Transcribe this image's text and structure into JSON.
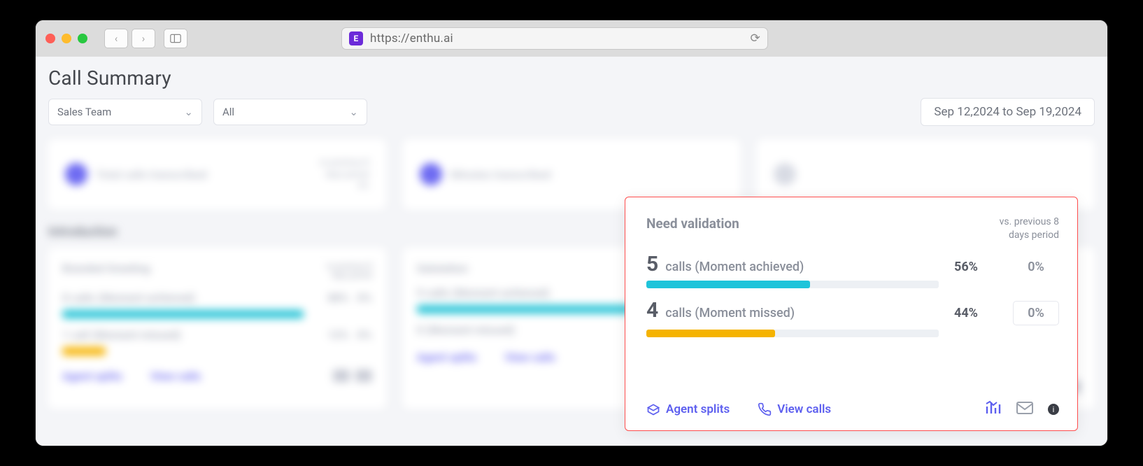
{
  "browser": {
    "url": "https://enthu.ai",
    "favicon_letter": "E"
  },
  "page": {
    "title": "Call Summary"
  },
  "filters": {
    "team": "Sales Team",
    "agent": "All",
    "date_range": "Sep 12,2024 to Sep 19,2024"
  },
  "validation_card": {
    "title": "Need validation",
    "compare_label_line1": "vs. previous 8",
    "compare_label_line2": "days period",
    "achieved": {
      "count": "5",
      "label": "calls (Moment achieved)",
      "pct": "56%",
      "prev_pct": "0%",
      "bar_pct": 56
    },
    "missed": {
      "count": "4",
      "label": "calls (Moment missed)",
      "pct": "44%",
      "prev_pct": "0%",
      "bar_pct": 44
    },
    "actions": {
      "agent_splits": "Agent splits",
      "view_calls": "View calls"
    }
  },
  "blurred": {
    "section": "Introduction",
    "card_a": "Branded Greeting",
    "card_b": "Salutation",
    "a_splits": "Agent splits",
    "v_calls": "View calls"
  }
}
